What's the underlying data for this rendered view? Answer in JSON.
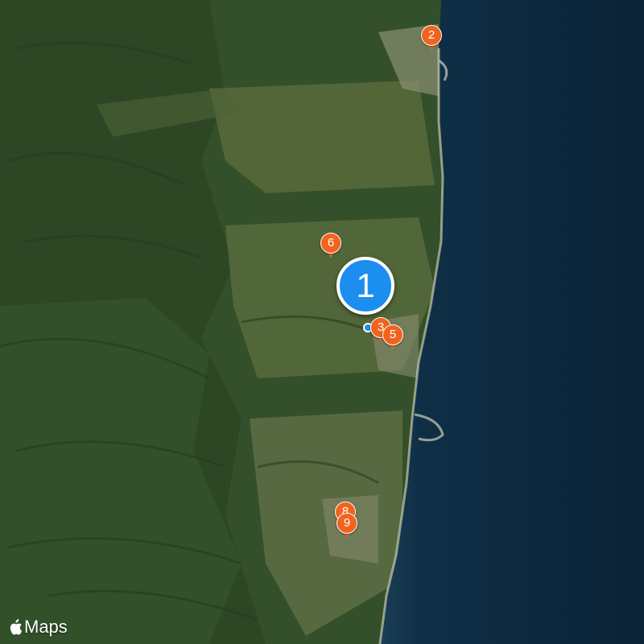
{
  "map": {
    "style": "satellite",
    "colors": {
      "ocean": "#0d2a40",
      "ocean_deep": "#0a2236",
      "forest": "#2f4a26",
      "farmland": "#6b7a4a",
      "coast": "#c9c6a8"
    }
  },
  "brand": {
    "text": "Maps",
    "icon": "apple-logo-icon"
  },
  "pins": [
    {
      "label": "1",
      "kind": "cluster",
      "color": "#1c8ef0"
    },
    {
      "label": "2",
      "kind": "marker",
      "color": "#f0641e"
    },
    {
      "label": "3",
      "kind": "marker",
      "color": "#f0641e"
    },
    {
      "label": "5",
      "kind": "marker",
      "color": "#f0641e"
    },
    {
      "label": "6",
      "kind": "marker",
      "color": "#f0641e"
    },
    {
      "label": "8",
      "kind": "marker",
      "color": "#f0641e"
    },
    {
      "label": "9",
      "kind": "marker",
      "color": "#f0641e"
    }
  ]
}
